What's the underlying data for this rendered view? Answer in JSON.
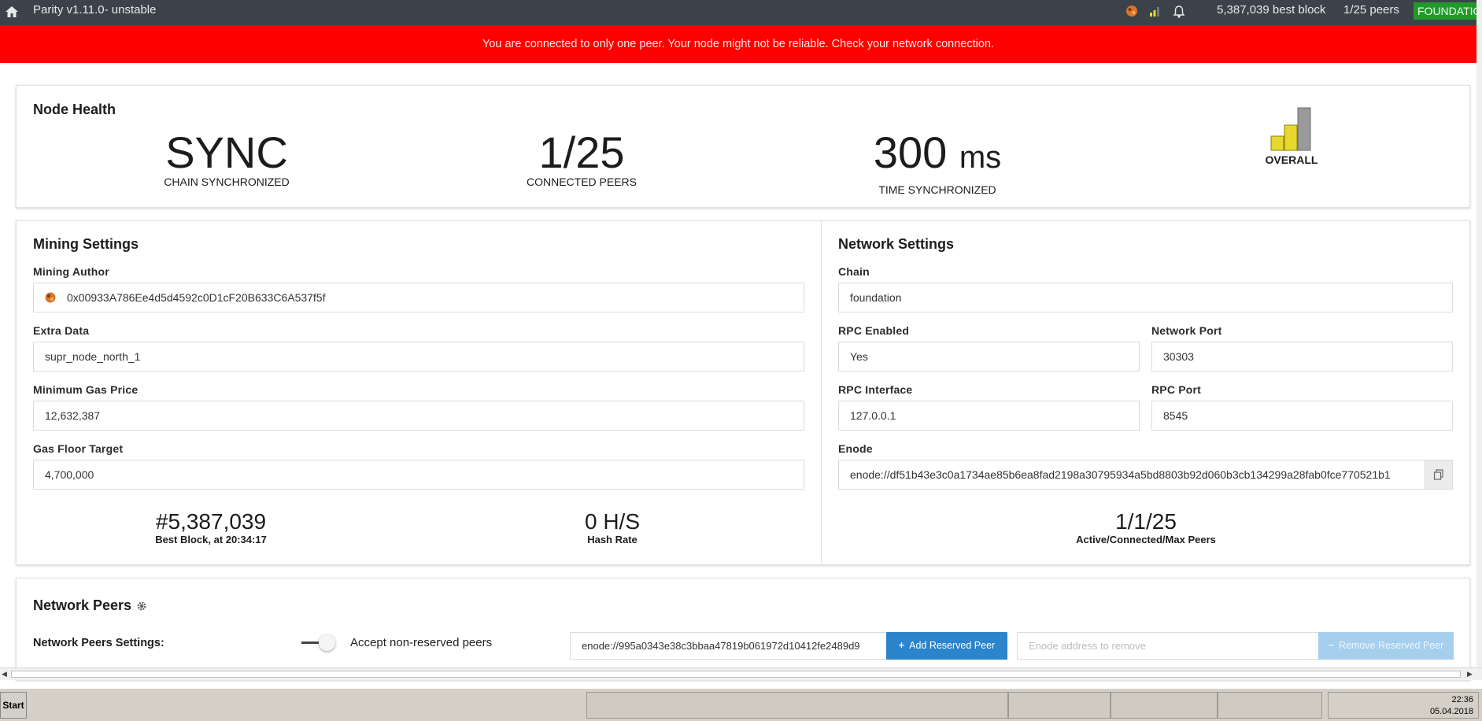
{
  "topbar": {
    "title": "Parity v1.11.0- unstable",
    "best_block": "5,387,039 best block",
    "peers": "1/25 peers",
    "chain_badge": "FOUNDATION"
  },
  "alert": {
    "text": "You are connected to only one peer. Your node might not be reliable. Check your network connection."
  },
  "node_health": {
    "title": "Node Health",
    "sync": {
      "value": "SYNC",
      "label": "CHAIN SYNCHRONIZED"
    },
    "peers": {
      "value": "1/25",
      "label": "CONNECTED PEERS"
    },
    "time": {
      "value": "300",
      "unit": "ms",
      "label": "TIME SYNCHRONIZED"
    },
    "overall": {
      "label": "OVERALL"
    }
  },
  "mining": {
    "title": "Mining Settings",
    "author_label": "Mining Author",
    "author_value": "0x00933A786Ee4d5d4592c0D1cF20B633C6A537f5f",
    "extra_label": "Extra Data",
    "extra_value": "supr_node_north_1",
    "min_gas_label": "Minimum Gas Price",
    "min_gas_value": "12,632,387",
    "gas_floor_label": "Gas Floor Target",
    "gas_floor_value": "4,700,000",
    "best_block_value": "#5,387,039",
    "best_block_label": "Best Block, at 20:34:17",
    "hash_rate_value": "0 H/S",
    "hash_rate_label": "Hash Rate"
  },
  "network": {
    "title": "Network Settings",
    "chain_label": "Chain",
    "chain_value": "foundation",
    "rpc_enabled_label": "RPC Enabled",
    "rpc_enabled_value": "Yes",
    "network_port_label": "Network Port",
    "network_port_value": "30303",
    "rpc_interface_label": "RPC Interface",
    "rpc_interface_value": "127.0.0.1",
    "rpc_port_label": "RPC Port",
    "rpc_port_value": "8545",
    "enode_label": "Enode",
    "enode_value": "enode://df51b43e3c0a1734ae85b6ea8fad2198a30795934a5bd8803b92d060b3cb134299a28fab0fce770521b1",
    "peers_value": "1/1/25",
    "peers_label": "Active/Connected/Max Peers"
  },
  "peers_section": {
    "title": "Network Peers",
    "settings_label": "Network Peers Settings:",
    "toggle_label": "Accept non-reserved peers",
    "add_input_value": "enode://995a0343e38c3bbaa47819b061972d10412fe2489d9",
    "add_button": "Add Reserved Peer",
    "remove_placeholder": "Enode address to remove",
    "remove_button": "Remove Reserved Peer"
  },
  "taskbar": {
    "start": "Start",
    "time": "22:36",
    "date": "05.04.2018"
  },
  "colors": {
    "alert_bg": "#ff0000",
    "topbar_bg": "#3b4249",
    "accent_blue": "#2b84cc",
    "badge_green": "#229a2a",
    "health_yellow": "#e7d82f"
  }
}
